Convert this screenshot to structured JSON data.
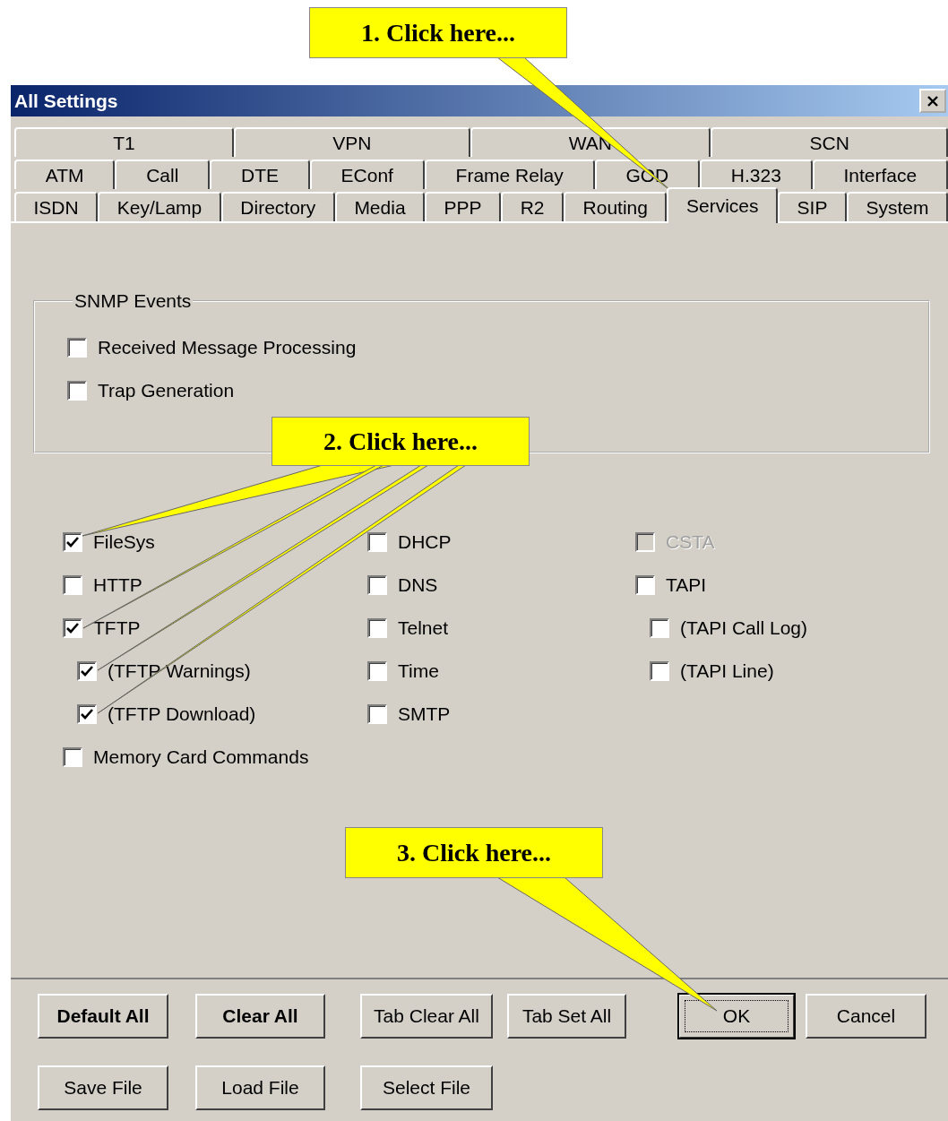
{
  "window": {
    "title": "All Settings"
  },
  "tab_rows": [
    [
      {
        "label": "T1",
        "selected": false
      },
      {
        "label": "VPN",
        "selected": false
      },
      {
        "label": "WAN",
        "selected": false
      },
      {
        "label": "SCN",
        "selected": false
      }
    ],
    [
      {
        "label": "ATM",
        "selected": false
      },
      {
        "label": "Call",
        "selected": false
      },
      {
        "label": "DTE",
        "selected": false
      },
      {
        "label": "EConf",
        "selected": false
      },
      {
        "label": "Frame Relay",
        "selected": false
      },
      {
        "label": "GOD",
        "selected": false
      },
      {
        "label": "H.323",
        "selected": false
      },
      {
        "label": "Interface",
        "selected": false
      }
    ],
    [
      {
        "label": "ISDN",
        "selected": false
      },
      {
        "label": "Key/Lamp",
        "selected": false
      },
      {
        "label": "Directory",
        "selected": false
      },
      {
        "label": "Media",
        "selected": false
      },
      {
        "label": "PPP",
        "selected": false
      },
      {
        "label": "R2",
        "selected": false
      },
      {
        "label": "Routing",
        "selected": false
      },
      {
        "label": "Services",
        "selected": true
      },
      {
        "label": "SIP",
        "selected": false
      },
      {
        "label": "System",
        "selected": false
      }
    ]
  ],
  "snmp_events": {
    "title": "SNMP Events",
    "options": [
      {
        "label": "Received Message Processing",
        "checked": false
      },
      {
        "label": "Trap Generation",
        "checked": false
      }
    ]
  },
  "service_columns": [
    [
      {
        "label": "FileSys",
        "checked": true,
        "disabled": false
      },
      {
        "label": "HTTP",
        "checked": false,
        "disabled": false
      },
      {
        "label": "TFTP",
        "checked": true,
        "disabled": false,
        "children": [
          {
            "label": "(TFTP Warnings)",
            "checked": true,
            "disabled": false
          },
          {
            "label": "(TFTP Download)",
            "checked": true,
            "disabled": false
          }
        ]
      },
      {
        "label": "Memory Card Commands",
        "checked": false,
        "disabled": false
      }
    ],
    [
      {
        "label": "DHCP",
        "checked": false,
        "disabled": false
      },
      {
        "label": "DNS",
        "checked": false,
        "disabled": false
      },
      {
        "label": "Telnet",
        "checked": false,
        "disabled": false
      },
      {
        "label": "Time",
        "checked": false,
        "disabled": false
      },
      {
        "label": "SMTP",
        "checked": false,
        "disabled": false
      }
    ],
    [
      {
        "label": "CSTA",
        "checked": false,
        "disabled": true
      },
      {
        "label": "TAPI",
        "checked": false,
        "disabled": false,
        "children": [
          {
            "label": "(TAPI Call Log)",
            "checked": false,
            "disabled": false
          },
          {
            "label": "(TAPI Line)",
            "checked": false,
            "disabled": false
          }
        ]
      }
    ]
  ],
  "button_rows": [
    [
      {
        "label": "Default All",
        "kind": "bold"
      },
      {
        "label": "Clear All",
        "kind": "bold"
      },
      {
        "label": "Tab Clear All",
        "kind": "normal"
      },
      {
        "label": "Tab Set All",
        "kind": "normal"
      },
      {
        "label": "OK",
        "kind": "default"
      },
      {
        "label": "Cancel",
        "kind": "normal"
      }
    ],
    [
      {
        "label": "Save File",
        "kind": "normal"
      },
      {
        "label": "Load File",
        "kind": "normal"
      },
      {
        "label": "Select File",
        "kind": "normal"
      }
    ]
  ],
  "callouts": [
    {
      "text": "1. Click here..."
    },
    {
      "text": "2. Click here..."
    },
    {
      "text": "3. Click here..."
    }
  ]
}
